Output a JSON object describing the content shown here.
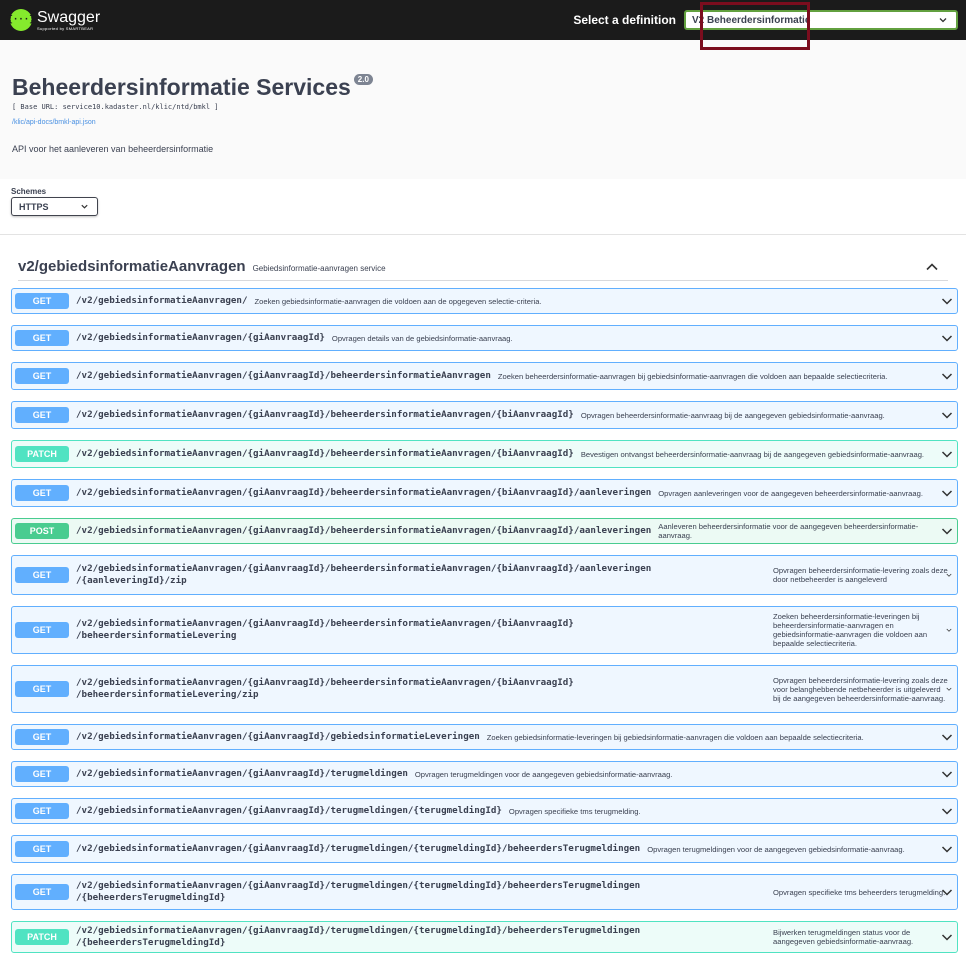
{
  "topbar": {
    "logo_glyph": "{···}",
    "logo_name": "Swagger",
    "logo_sub": "Supported by SMARTBEAR",
    "definition_label": "Select a definition",
    "definition_value": "V2 Beheerdersinformatie"
  },
  "info": {
    "title": "Beheerdersinformatie Services",
    "version": "2.0",
    "base_url": "[ Base URL: service10.kadaster.nl/klic/ntd/bmkl ]",
    "spec_link": "/klic/api-docs/bmkl-api.json",
    "description": "API voor het aanleveren van beheerdersinformatie"
  },
  "schemes": {
    "label": "Schemes",
    "value": "HTTPS"
  },
  "tag": {
    "name": "v2/gebiedsinformatieAanvragen",
    "description": "Gebiedsinformatie-aanvragen service"
  },
  "operations": [
    {
      "method": "GET",
      "path": "/v2/gebiedsinformatieAanvragen/",
      "summary": "Zoeken gebiedsinformatie-aanvragen die voldoen aan de opgegeven selectie-criteria."
    },
    {
      "method": "GET",
      "path": "/v2/gebiedsinformatieAanvragen/{giAanvraagId}",
      "summary": "Opvragen details van de gebiedsinformatie-aanvraag."
    },
    {
      "method": "GET",
      "path": "/v2/gebiedsinformatieAanvragen/{giAanvraagId}/beheerdersinformatieAanvragen",
      "summary": "Zoeken beheerdersinformatie-aanvragen bij gebiedsinformatie-aanvragen die voldoen aan bepaalde selectiecriteria."
    },
    {
      "method": "GET",
      "path": "/v2/gebiedsinformatieAanvragen/{giAanvraagId}/beheerdersinformatieAanvragen/{biAanvraagId}",
      "summary": "Opvragen beheerdersinformatie-aanvraag bij de aangegeven gebiedsinformatie-aanvraag."
    },
    {
      "method": "PATCH",
      "path": "/v2/gebiedsinformatieAanvragen/{giAanvraagId}/beheerdersinformatieAanvragen/{biAanvraagId}",
      "summary": "Bevestigen ontvangst beheerdersinformatie-aanvraag bij de aangegeven gebiedsinformatie-aanvraag."
    },
    {
      "method": "GET",
      "path": "/v2/gebiedsinformatieAanvragen/{giAanvraagId}/beheerdersinformatieAanvragen/{biAanvraagId}/aanleveringen",
      "summary": "Opvragen aanleveringen voor de aangegeven beheerdersinformatie-aanvraag."
    },
    {
      "method": "POST",
      "path": "/v2/gebiedsinformatieAanvragen/{giAanvraagId}/beheerdersinformatieAanvragen/{biAanvraagId}/aanleveringen",
      "summary": "Aanleveren beheerdersinformatie voor de aangegeven beheerdersinformatie-aanvraag."
    },
    {
      "method": "GET",
      "path": "/v2/gebiedsinformatieAanvragen/{giAanvraagId}/beheerdersinformatieAanvragen/{biAanvraagId}/aanleveringen\n/{aanleveringId}/zip",
      "summary": "Opvragen beheerdersinformatie-levering zoals deze door netbeheerder is aangeleverd"
    },
    {
      "method": "GET",
      "path": "/v2/gebiedsinformatieAanvragen/{giAanvraagId}/beheerdersinformatieAanvragen/{biAanvraagId}\n/beheerdersinformatieLevering",
      "summary": "Zoeken beheerdersinformatie-leveringen bij beheerdersinformatie-aanvragen en gebiedsinformatie-aanvragen die voldoen aan bepaalde selectiecriteria."
    },
    {
      "method": "GET",
      "path": "/v2/gebiedsinformatieAanvragen/{giAanvraagId}/beheerdersinformatieAanvragen/{biAanvraagId}\n/beheerdersinformatieLevering/zip",
      "summary": "Opvragen beheerdersinformatie-levering zoals deze voor belanghebbende netbeheerder is uitgeleverd bij de aangegeven beheerdersinformatie-aanvraag."
    },
    {
      "method": "GET",
      "path": "/v2/gebiedsinformatieAanvragen/{giAanvraagId}/gebiedsinformatieLeveringen",
      "summary": "Zoeken gebiedsinformatie-leveringen bij gebiedsinformatie-aanvragen die voldoen aan bepaalde selectiecriteria."
    },
    {
      "method": "GET",
      "path": "/v2/gebiedsinformatieAanvragen/{giAanvraagId}/terugmeldingen",
      "summary": "Opvragen terugmeldingen voor de aangegeven gebiedsinformatie-aanvraag."
    },
    {
      "method": "GET",
      "path": "/v2/gebiedsinformatieAanvragen/{giAanvraagId}/terugmeldingen/{terugmeldingId}",
      "summary": "Opvragen specifieke tms terugmelding."
    },
    {
      "method": "GET",
      "path": "/v2/gebiedsinformatieAanvragen/{giAanvraagId}/terugmeldingen/{terugmeldingId}/beheerdersTerugmeldingen",
      "summary": "Opvragen terugmeldingen voor de aangegeven gebiedsinformatie-aanvraag."
    },
    {
      "method": "GET",
      "path": "/v2/gebiedsinformatieAanvragen/{giAanvraagId}/terugmeldingen/{terugmeldingId}/beheerdersTerugmeldingen\n/{beheerdersTerugmeldingId}",
      "summary": "Opvragen specifieke tms beheerders terugmelding."
    },
    {
      "method": "PATCH",
      "path": "/v2/gebiedsinformatieAanvragen/{giAanvraagId}/terugmeldingen/{terugmeldingId}/beheerdersTerugmeldingen\n/{beheerdersTerugmeldingId}",
      "summary": "Bijwerken terugmeldingen status voor de aangegeven gebiedsinformatie-aanvraag."
    }
  ]
}
